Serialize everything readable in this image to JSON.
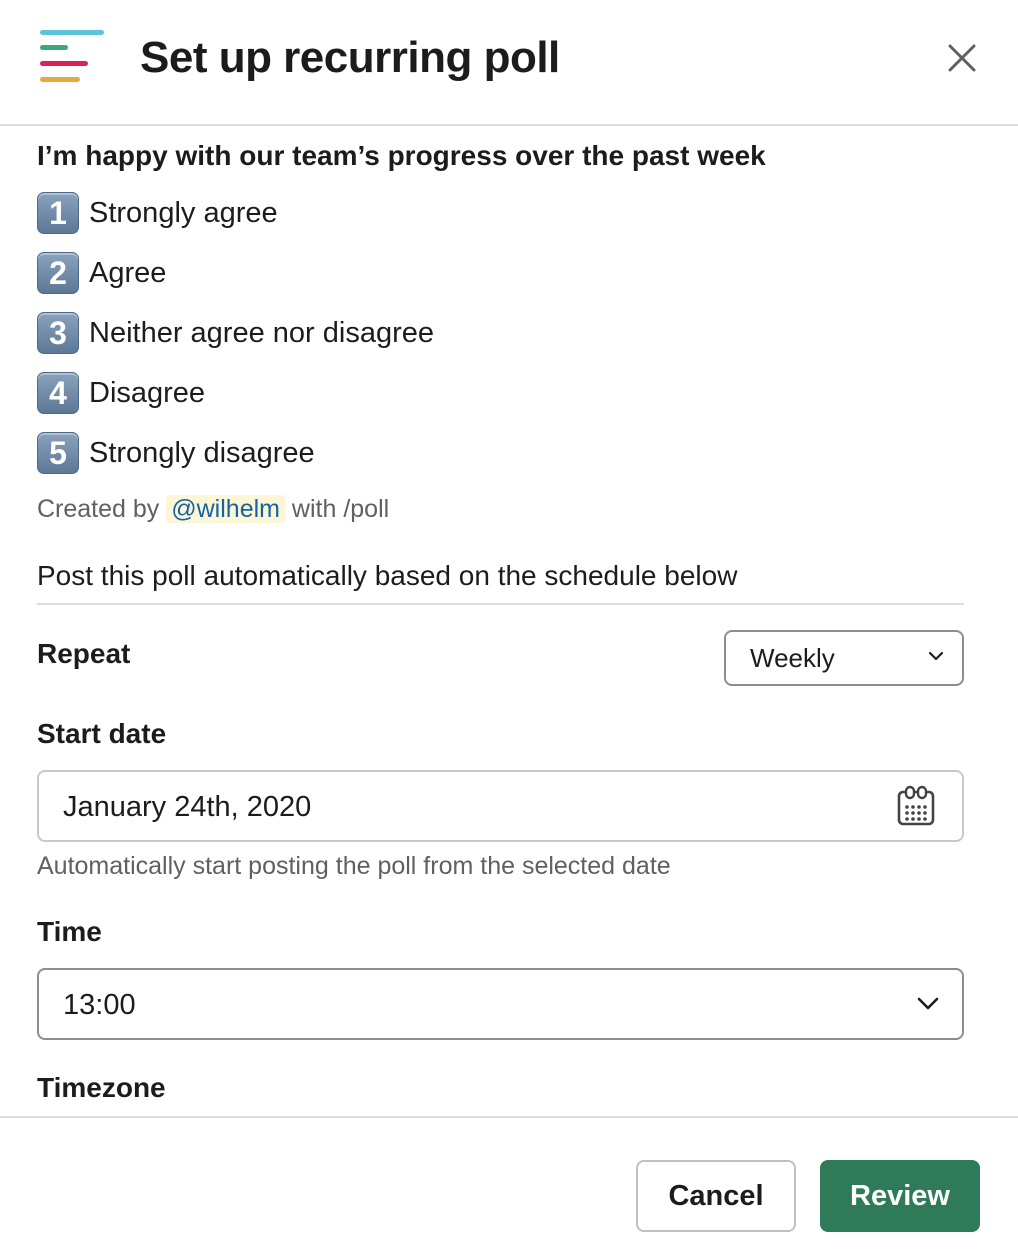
{
  "header": {
    "title": "Set up recurring poll",
    "logo_colors": [
      "#5bc4d6",
      "#3aa877",
      "#e01e5a",
      "#e8a83c"
    ]
  },
  "poll": {
    "question": "I’m happy with our team’s progress over the past week",
    "options": [
      {
        "number": "1",
        "label": "Strongly agree"
      },
      {
        "number": "2",
        "label": "Agree"
      },
      {
        "number": "3",
        "label": "Neither agree nor disagree"
      },
      {
        "number": "4",
        "label": "Disagree"
      },
      {
        "number": "5",
        "label": "Strongly disagree"
      }
    ],
    "created_prefix": "Created by ",
    "created_user": "@wilhelm",
    "created_suffix": " with /poll"
  },
  "schedule": {
    "description": "Post this poll automatically based on the schedule below",
    "repeat": {
      "label": "Repeat",
      "value": "Weekly"
    },
    "start_date": {
      "label": "Start date",
      "value": "January 24th, 2020",
      "hint": "Automatically start posting the poll from the selected date"
    },
    "time": {
      "label": "Time",
      "value": "13:00"
    },
    "timezone": {
      "label": "Timezone"
    }
  },
  "footer": {
    "cancel_label": "Cancel",
    "review_label": "Review",
    "review_color": "#2f7a58"
  }
}
